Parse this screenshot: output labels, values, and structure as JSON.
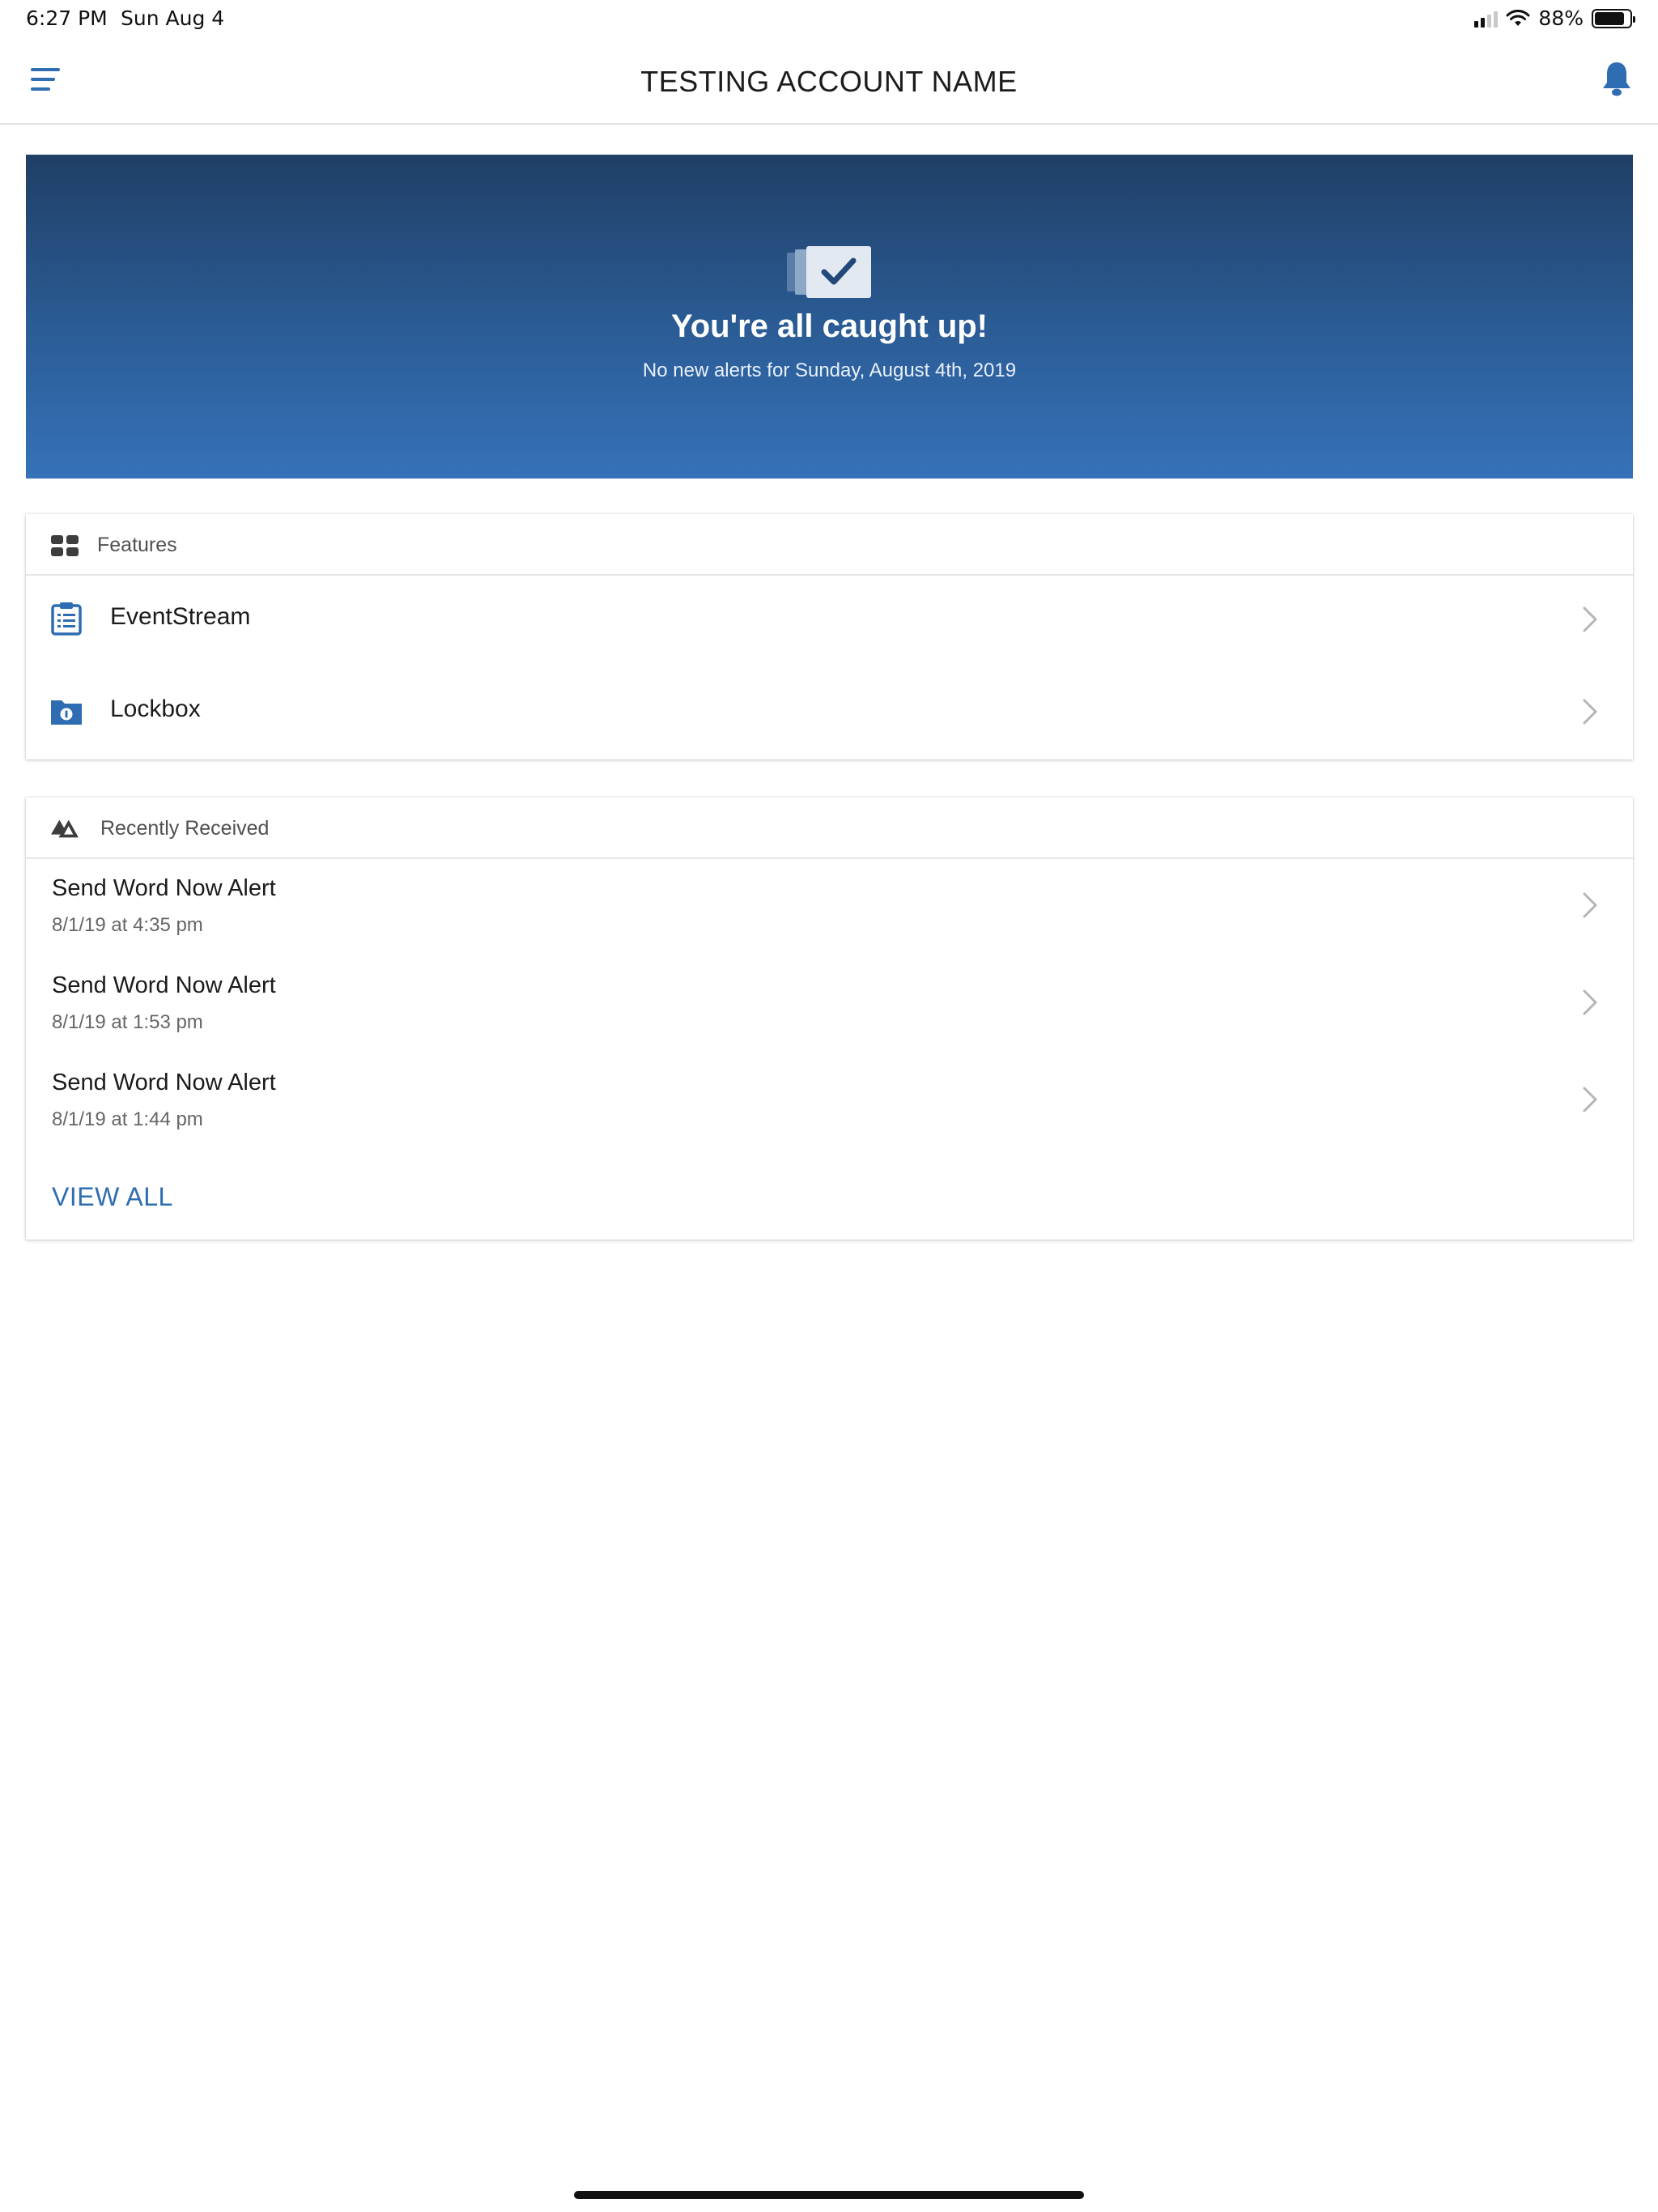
{
  "status_bar": {
    "time": "6:27 PM",
    "date": "Sun Aug 4",
    "battery": "88%",
    "battery_level": 0.88
  },
  "nav": {
    "title": "TESTING ACCOUNT NAME",
    "menu_icon": "hamburger-menu-icon",
    "bell_icon": "bell-icon"
  },
  "hero": {
    "title": "You're all caught up!",
    "subtitle": "No new alerts for Sunday, August 4th, 2019",
    "icon": "check-stack-icon"
  },
  "features": {
    "header": "Features",
    "items": [
      {
        "label": "EventStream",
        "icon": "clipboard-list-icon"
      },
      {
        "label": "Lockbox",
        "icon": "lockbox-folder-icon"
      }
    ]
  },
  "recent": {
    "header": "Recently Received",
    "items": [
      {
        "title": "Send Word Now Alert",
        "time": "8/1/19 at 4:35 pm"
      },
      {
        "title": "Send Word Now Alert",
        "time": "8/1/19 at 1:53 pm"
      },
      {
        "title": "Send Word Now Alert",
        "time": "8/1/19 at 1:44 pm"
      }
    ],
    "view_all": "VIEW ALL"
  },
  "colors": {
    "accent": "#2f6db2",
    "hero_top": "#203f66",
    "hero_bottom": "#3672b9"
  }
}
